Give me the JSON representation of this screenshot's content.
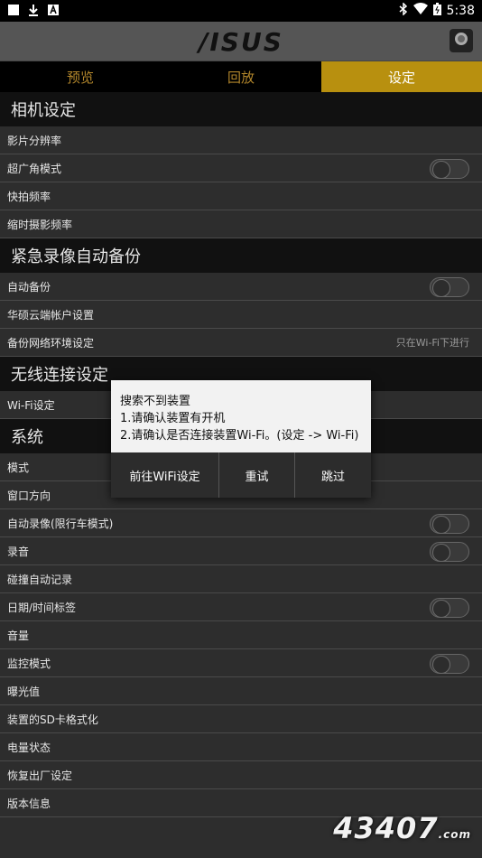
{
  "status_bar": {
    "time": "5:38"
  },
  "app": {
    "logo": "/ISUS"
  },
  "tabs": [
    {
      "label": "预览"
    },
    {
      "label": "回放"
    },
    {
      "label": "设定"
    }
  ],
  "sections": {
    "camera": {
      "title": "相机设定",
      "items": [
        "影片分辨率",
        "超广角模式",
        "快拍频率",
        "缩时摄影频率"
      ]
    },
    "emergency": {
      "title": "紧急录像自动备份",
      "items": [
        "自动备份",
        "华硕云端帐户设置",
        "备份网络环境设定"
      ],
      "backup_network_value": "只在Wi-Fi下进行"
    },
    "wireless": {
      "title": "无线连接设定",
      "items": [
        "Wi-Fi设定"
      ]
    },
    "system": {
      "title": "系统",
      "items": [
        "模式",
        "窗口方向",
        "自动录像(限行车模式)",
        "录音",
        "碰撞自动记录",
        "日期/时间标签",
        "音量",
        "监控模式",
        "曝光值",
        "装置的SD卡格式化",
        "电量状态",
        "恢复出厂设定",
        "版本信息"
      ]
    }
  },
  "dialog": {
    "title": "搜索不到装置",
    "line1": "1.请确认装置有开机",
    "line2": "2.请确认是否连接装置Wi-Fi。(设定 -> Wi-Fi)",
    "btn_wifi": "前往WiFi设定",
    "btn_retry": "重试",
    "btn_skip": "跳过"
  },
  "watermark": {
    "text": "43407",
    "suffix": ".com"
  },
  "colors": {
    "accent": "#b8900f",
    "tab_inactive_text": "#b2862b",
    "section_bg": "#111111",
    "row_bg": "#2d2d2d"
  }
}
